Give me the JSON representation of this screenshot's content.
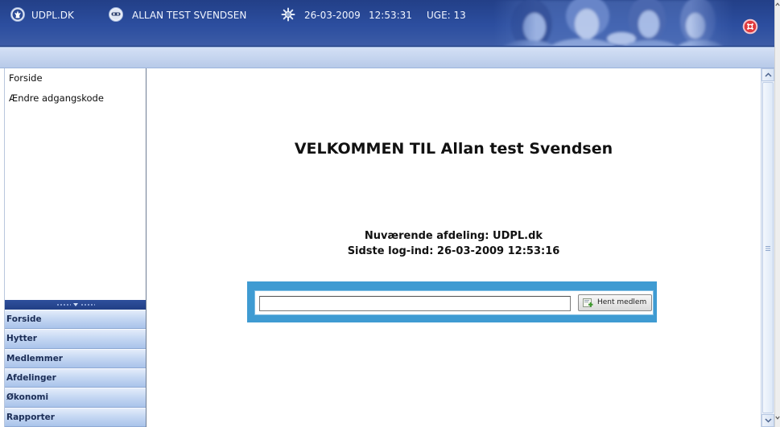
{
  "colors": {
    "header_bg": "#2c4e9f",
    "subheader_bg": "#bdd0f0",
    "menu_text": "#1b2d56",
    "search_frame": "#3f9bd2",
    "logout": "#e0393d"
  },
  "header": {
    "site": {
      "icon": "logo-icon",
      "label": "UDPL.DK"
    },
    "user": {
      "icon": "user-icon",
      "label": "ALLAN TEST SVENDSEN"
    },
    "status": {
      "icon": "settings-icon",
      "date": "26-03-2009",
      "time": "12:53:31",
      "week": "UGE: 13"
    },
    "logout": {
      "icon": "logout-icon"
    }
  },
  "sidebar": {
    "links": [
      {
        "label": "Forside"
      },
      {
        "label": "Ændre adgangskode"
      }
    ],
    "splitter_icon": "chevron-down-icon",
    "menu": [
      {
        "label": "Forside"
      },
      {
        "label": "Hytter"
      },
      {
        "label": "Medlemmer"
      },
      {
        "label": "Afdelinger"
      },
      {
        "label": "Økonomi"
      },
      {
        "label": "Rapporter"
      }
    ]
  },
  "main": {
    "welcome_title": "VELKOMMEN TIL Allan test Svendsen",
    "department": "Nuværende afdeling: UDPL.dk",
    "last_login": "Sidste log-ind: 26-03-2009 12:53:16",
    "member_search": {
      "value": "",
      "button_icon": "fetch-member-icon",
      "button_label": "Hent medlem"
    }
  }
}
